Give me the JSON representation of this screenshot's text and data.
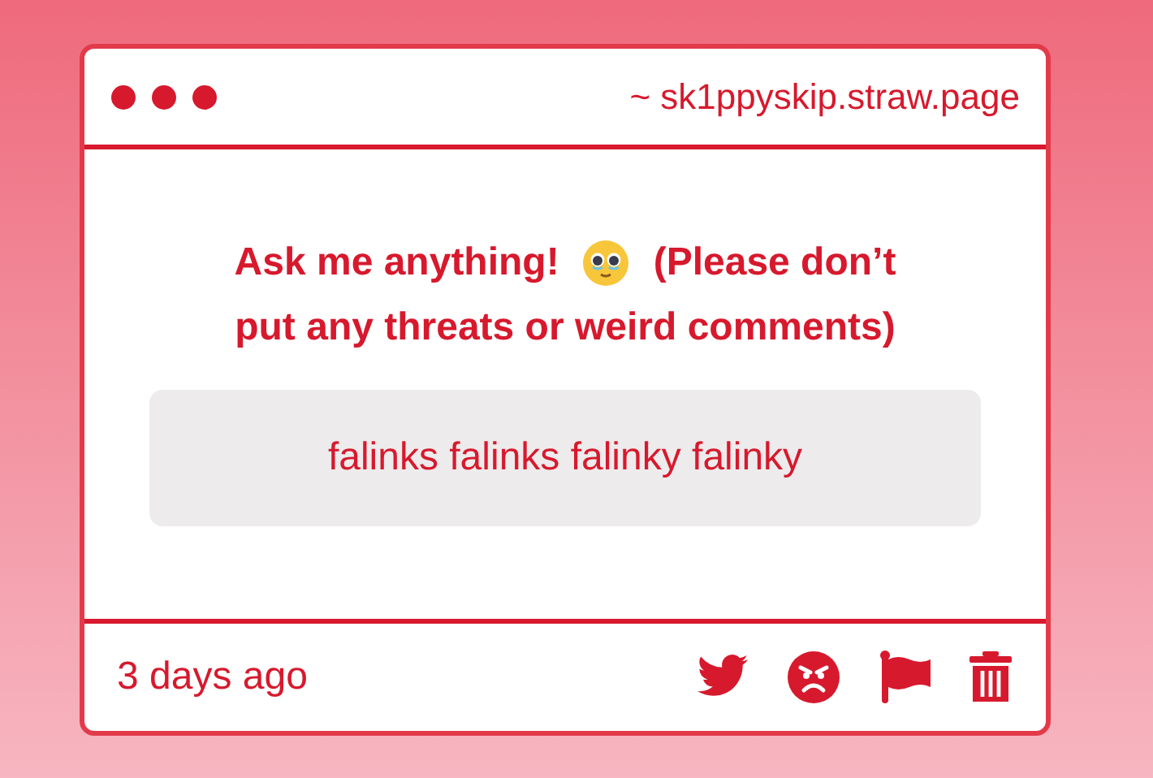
{
  "header": {
    "address": "~ sk1ppyskip.straw.page"
  },
  "question": {
    "before_emoji": "Ask me anything!",
    "after_emoji": "(Please don’t",
    "second_line": "put any threats or weird comments)"
  },
  "answer": "falinks falinks falinky falinky",
  "footer": {
    "time": "3 days ago"
  }
}
